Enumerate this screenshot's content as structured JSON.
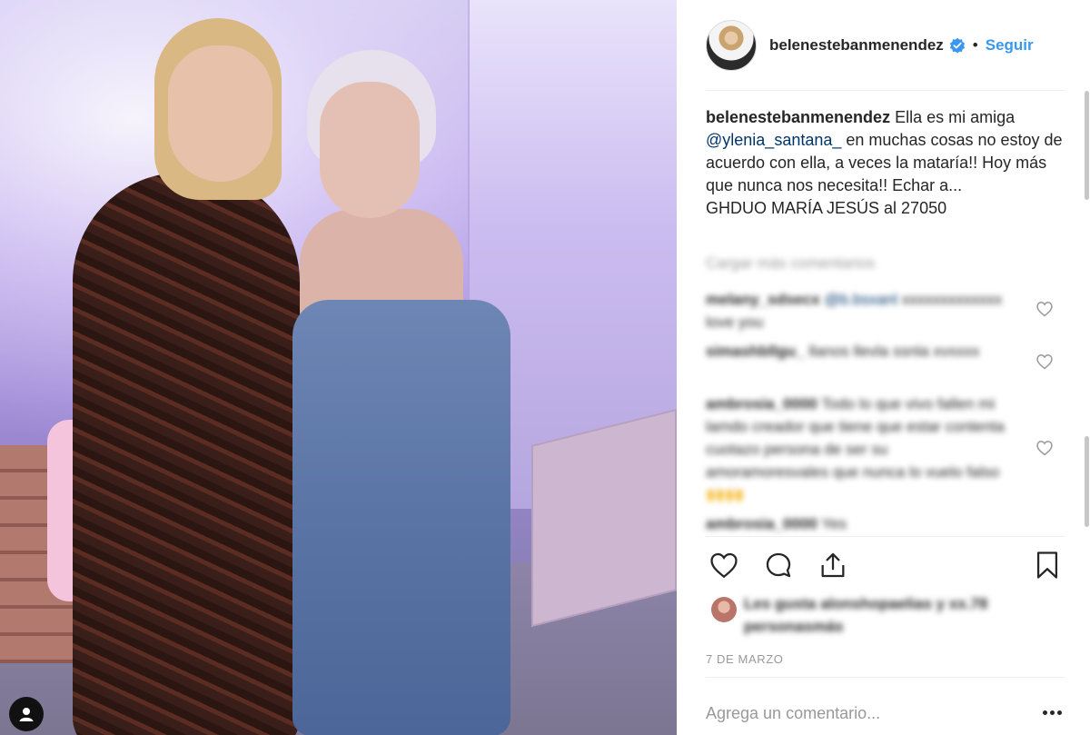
{
  "header": {
    "username": "belenestebanmenendez",
    "dot": "•",
    "follow_label": "Seguir"
  },
  "caption": {
    "username": "belenestebanmenendez",
    "text_1": "Ella es mi amiga",
    "mention": "@ylenia_santana_",
    "text_2": "en muchas cosas no estoy de acuerdo con ella, a veces la mataría!! Hoy más que nunca nos necesita!! Echar a...",
    "text_3": "GHDUO MARÍA JESÚS al 27050"
  },
  "view_more": "Cargar más comentarios",
  "comments": [
    {
      "user": "melany_sdsecx",
      "tag": "@b.bsxanl",
      "text": "xxxxxxxxxxxxx love you"
    },
    {
      "user": "simashbllgu_",
      "tag": "",
      "text": "llanos llevla ssnla xvxxxx"
    },
    {
      "user": "ambrosia_0000",
      "tag": "",
      "text": "Todo lo que vivo fallen mi lamdo creador que tiene que estar contenta cuotazo persona de ser su amoramoresvales que nunca lo vuelo falso 🙌🙌"
    },
    {
      "user": "ambrosia_0000",
      "tag": "",
      "text": "Yes"
    }
  ],
  "likes": {
    "text": "Les gusta alonshopaelias y xx.78 personasmás"
  },
  "date": "7 DE MARZO",
  "comment_box": {
    "placeholder": "Agrega un comentario..."
  },
  "colors": {
    "link": "#3897f0",
    "mention": "#003569",
    "muted": "#999999",
    "text": "#262626"
  },
  "icons": [
    "verified-badge-icon",
    "heart-icon",
    "comment-icon",
    "share-icon",
    "bookmark-icon",
    "more-icon",
    "user-icon"
  ]
}
